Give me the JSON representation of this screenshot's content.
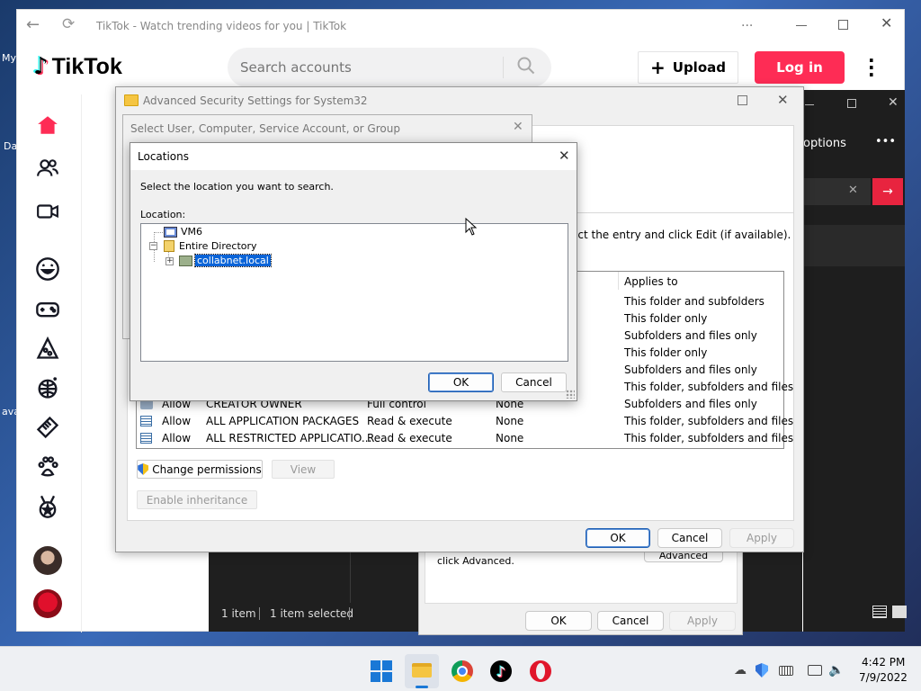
{
  "desktop": {
    "left_labels": [
      "My",
      "Da",
      "ava"
    ]
  },
  "browser": {
    "title": "TikTok - Watch trending videos for you | TikTok",
    "more": "···",
    "logo_text": "TikTok",
    "search_placeholder": "Search accounts",
    "upload_label": "Upload",
    "login_label": "Log in"
  },
  "back_window": {
    "options_label": "options",
    "more": "•••"
  },
  "explorer": {
    "status_items": "1 item",
    "status_selected": "1 item selected"
  },
  "props_dialog": {
    "advanced_text": "click Advanced.",
    "advanced_btn": "Advanced",
    "ok": "OK",
    "cancel": "Cancel",
    "apply": "Apply"
  },
  "adv_security": {
    "title": "Advanced Security Settings for System32",
    "instruction": "ect the entry and click Edit (if available).",
    "col_applies": "Applies to",
    "applies_rows": [
      "This folder and subfolders",
      "This folder only",
      "Subfolders and files only",
      "This folder only",
      "Subfolders and files only",
      "This folder, subfolders and files"
    ],
    "entries": [
      {
        "type": "Allow",
        "principal": "CREATOR OWNER",
        "access": "Full control",
        "inherited": "None",
        "applies": "Subfolders and files only"
      },
      {
        "type": "Allow",
        "principal": "ALL APPLICATION PACKAGES",
        "access": "Read & execute",
        "inherited": "None",
        "applies": "This folder, subfolders and files"
      },
      {
        "type": "Allow",
        "principal": "ALL RESTRICTED APPLICATIO...",
        "access": "Read & execute",
        "inherited": "None",
        "applies": "This folder, subfolders and files"
      }
    ],
    "change_permissions": "Change permissions",
    "view": "View",
    "enable_inheritance": "Enable inheritance",
    "ok": "OK",
    "cancel": "Cancel",
    "apply": "Apply"
  },
  "select_user": {
    "title": "Select User, Computer, Service Account, or Group"
  },
  "locations": {
    "title": "Locations",
    "prompt": "Select the location you want to search.",
    "location_label": "Location:",
    "tree": {
      "node1": "VM6",
      "node2": "Entire Directory",
      "node3": "collabnet.local"
    },
    "ok": "OK",
    "cancel": "Cancel"
  },
  "taskbar": {
    "time": "4:42 PM",
    "date": "7/9/2022"
  }
}
